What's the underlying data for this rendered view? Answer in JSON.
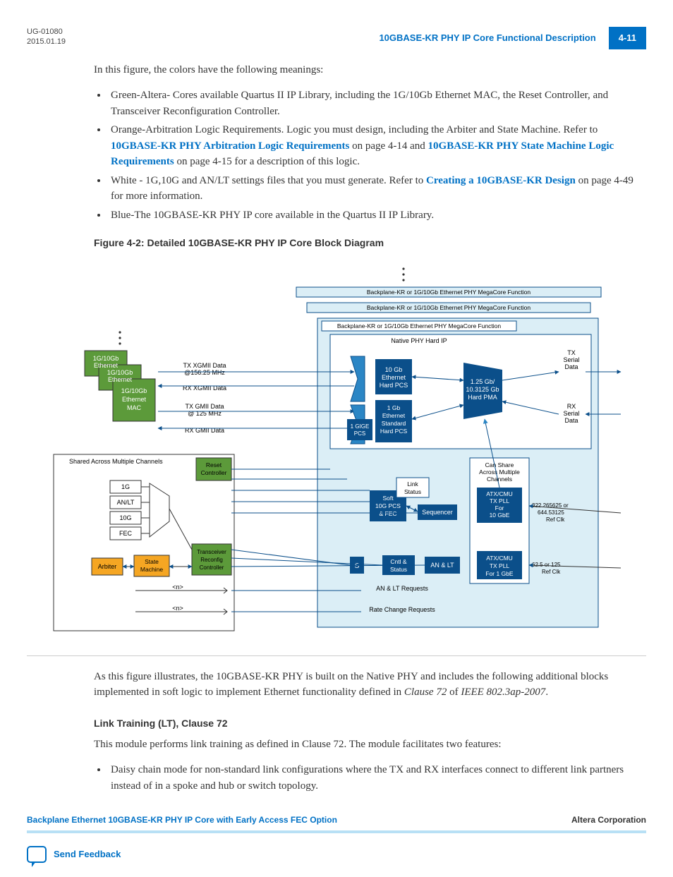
{
  "header": {
    "docId": "UG-01080",
    "date": "2015.01.19",
    "sectionTitle": "10GBASE-KR PHY IP Core Functional Description",
    "pageNum": "4-11"
  },
  "intro": "In this figure, the colors have the following meanings:",
  "bullets1": {
    "b1": "Green-Altera- Cores available Quartus II IP Library, including the 1G/10Gb Ethernet MAC, the Reset Controller, and Transceiver Reconfiguration Controller.",
    "b2a": "Orange-Arbitration Logic Requirements. Logic you must design, including the Arbiter and State Machine. Refer to ",
    "b2link1": "10GBASE-KR PHY Arbitration Logic Requirements",
    "b2b": " on page 4-14 and ",
    "b2link2": "10GBASE-KR PHY State Machine Logic Requirements",
    "b2c": " on page 4-15 for a description of this logic.",
    "b3a": "White - 1G,10G and AN/LT settings files that you must generate. Refer to ",
    "b3link": "Creating a 10GBASE-KR Design",
    "b3b": " on page 4-49 for more information.",
    "b4": "Blue-The 10GBASE-KR PHY IP core available in the Quartus II IP Library."
  },
  "figCaption": "Figure 4-2: Detailed 10GBASE-KR PHY IP Core Block Diagram",
  "diagram": {
    "outerLabels": {
      "l1": "Backplane-KR or 1G/10Gb Ethernet PHY MegaCore Function",
      "l2": "Backplane-KR or 1G/10Gb Ethernet PHY MegaCore Function",
      "l3": "Backplane-KR or 1G/10Gb Ethernet PHY MegaCore Function"
    },
    "nativePHY": "Native PHY Hard IP",
    "mac": {
      "l1": "1G/10Gb",
      "l2": "Ethernet",
      "mac": "MAC"
    },
    "txXgmii1": "TX XGMII Data",
    "txXgmii2": "@156.25 MHz",
    "rxXgmii": "RX XGMII Data",
    "txGmii1": "TX GMII Data",
    "txGmii2": "@ 125 MHz",
    "rxGmii": "RX GMII Data",
    "tenGbPCS": {
      "l1": "10 Gb",
      "l2": "Ethernet",
      "l3": "Hard PCS"
    },
    "oneGbPCS": {
      "l1": "1 Gb",
      "l2": "Ethernet",
      "l3": "Standard",
      "l4": "Hard PCS"
    },
    "pma": {
      "l1": "1.25 Gb/",
      "l2": "10.3125 Gb",
      "l3": "Hard PMA"
    },
    "txSerial": {
      "l1": "TX",
      "l2": "Serial",
      "l3": "Data"
    },
    "rxSerial": {
      "l1": "RX",
      "l2": "Serial",
      "l3": "Data"
    },
    "shared": "Shared Across Multiple Channels",
    "reset": {
      "l1": "Reset",
      "l2": "Controller"
    },
    "oneG": "1G",
    "anlt": "AN/LT",
    "tenG": "10G",
    "fec": "FEC",
    "arbiter": "Arbiter",
    "stateMachine": {
      "l1": "State",
      "l2": "Machine"
    },
    "reconfig": {
      "l1": "Transceiver",
      "l2": "Reconfig",
      "l3": "Controller"
    },
    "oneGigePCS": {
      "l1": "1 GIGE",
      "l2": "PCS"
    },
    "softPCS": {
      "l1": "Soft",
      "l2": "10G PCS",
      "l3": "& FEC"
    },
    "sequencer": "Sequencer",
    "linkStatus": {
      "l1": "Link",
      "l2": "Status"
    },
    "s": "S",
    "cntl": {
      "l1": "Cntl &",
      "l2": "Status"
    },
    "anltBlock": "AN & LT",
    "canShare": {
      "l1": "Can Share",
      "l2": "Across Multiple",
      "l3": "Channels"
    },
    "pll10": {
      "l1": "ATX/CMU",
      "l2": "TX PLL",
      "l3": "For",
      "l4": "10 GbE"
    },
    "pll1": {
      "l1": "ATX/CMU",
      "l2": "TX PLL",
      "l3": "For 1 GbE"
    },
    "ref10": {
      "l1": "322.265625 or",
      "l2": "644.53125",
      "l3": "Ref Clk"
    },
    "ref1": {
      "l1": "62.5 or 125",
      "l2": "Ref Clk"
    },
    "anltReq": "AN & LT Requests",
    "rateChange": "Rate Change Requests",
    "n": "<n>"
  },
  "afterFig": {
    "p1a": "As this figure illustrates, the 10GBASE-KR PHY is built on the Native PHY and includes the following additional blocks implemented in soft logic to implement Ethernet functionality defined in ",
    "p1em": "Clause 72",
    "p1b": " of ",
    "p1em2": "IEEE 802.3ap-2007",
    "p1c": "."
  },
  "subhead": "Link Training (LT), Clause 72",
  "ltIntro": "This module performs link training as defined in Clause 72. The module facilitates two features:",
  "bullets2": {
    "b1": "Daisy chain mode for non-standard link configurations where the TX and RX interfaces connect to different link partners instead of in a spoke and hub or switch topology."
  },
  "footer": {
    "left": "Backplane Ethernet 10GBASE-KR PHY IP Core with Early Access FEC Option",
    "right": "Altera Corporation",
    "feedback": "Send Feedback"
  }
}
